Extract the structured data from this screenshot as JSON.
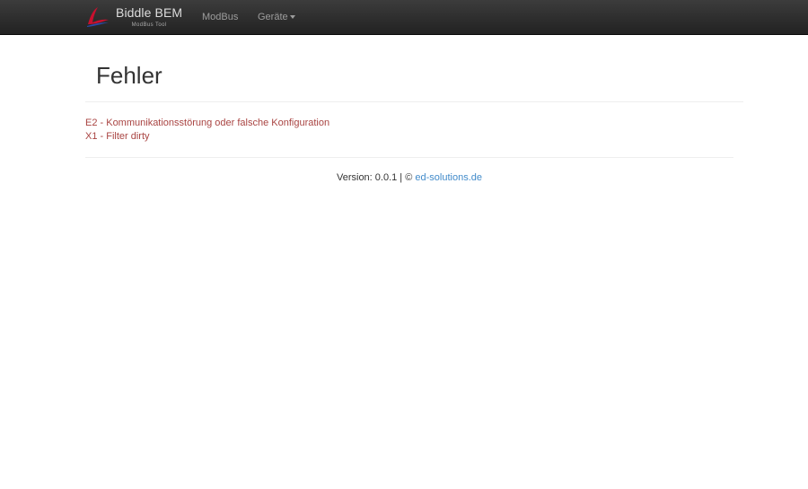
{
  "navbar": {
    "brand_title": "Biddle BEM",
    "brand_subtitle": "ModBus Tool",
    "items": [
      {
        "label": "ModBus"
      },
      {
        "label": "Geräte"
      }
    ]
  },
  "page": {
    "title": "Fehler"
  },
  "errors": [
    "E2 - Kommunikationsstörung oder falsche Konfiguration",
    "X1 - Filter dirty"
  ],
  "footer": {
    "version_text": "Version: 0.0.1 | ©",
    "link_text": "ed-solutions.de"
  },
  "colors": {
    "navbar_bg": "#222222",
    "error_text": "#a94442",
    "link": "#428bca"
  },
  "icons": {
    "brand_logo": "biddle-logo-icon",
    "dropdown": "caret-down-icon"
  }
}
